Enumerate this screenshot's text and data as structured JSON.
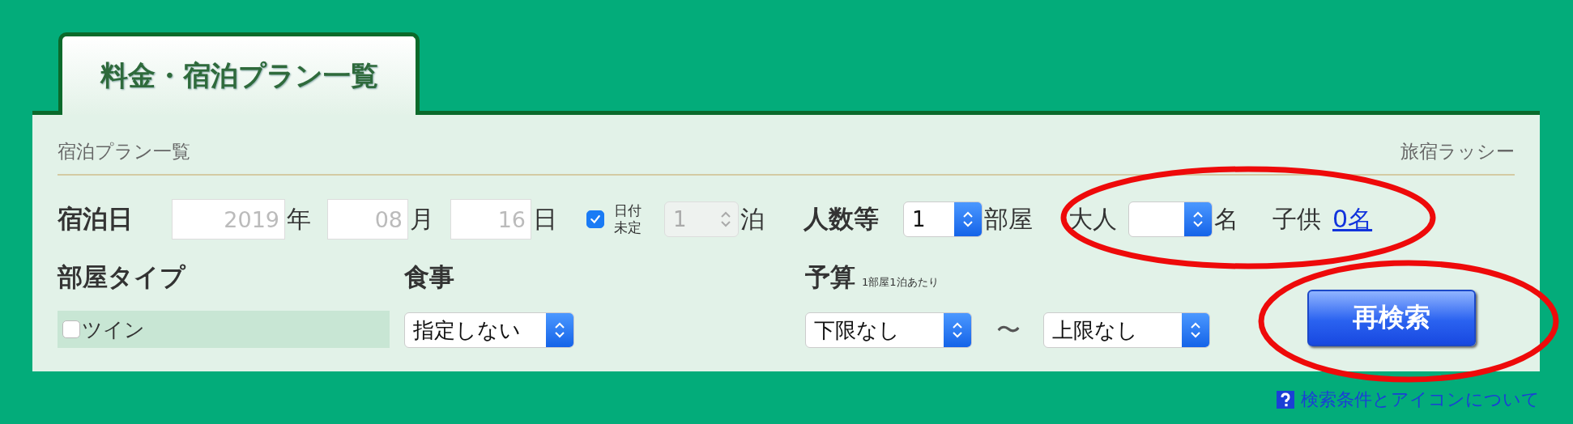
{
  "tab": {
    "label": "料金・宿泊プラン一覧",
    "selected": true
  },
  "header": {
    "title": "宿泊プラン一覧",
    "inn_name": "旅宿ラッシー"
  },
  "stay_date": {
    "label": "宿泊日",
    "fields": [
      {
        "placeholder": "2019",
        "unit": "年"
      },
      {
        "placeholder": "08",
        "unit": "月"
      },
      {
        "placeholder": "16",
        "unit": "日"
      }
    ],
    "undecided": {
      "label_lines": [
        "日付",
        "未定"
      ],
      "checked": true
    },
    "nights": {
      "value": "1",
      "unit": "泊",
      "disabled": true
    }
  },
  "guests": {
    "label": "人数等",
    "highlighted": true,
    "rooms": {
      "value": "1",
      "unit": "部屋"
    },
    "adults": {
      "label": "大人",
      "unit": "名"
    },
    "children": {
      "label": "子供",
      "link": "0名"
    }
  },
  "room_type": {
    "label": "部屋タイプ",
    "options": [
      {
        "label": "ツイン",
        "checked": false
      }
    ]
  },
  "meal": {
    "label": "食事",
    "value": "指定しない"
  },
  "budget": {
    "label": "予算",
    "note": "1部屋1泊あたり",
    "min": "下限なし",
    "separator": "〜",
    "max": "上限なし"
  },
  "search_button": {
    "label": "再検索",
    "highlighted": true
  },
  "help_link": "検索条件とアイコンについて"
}
